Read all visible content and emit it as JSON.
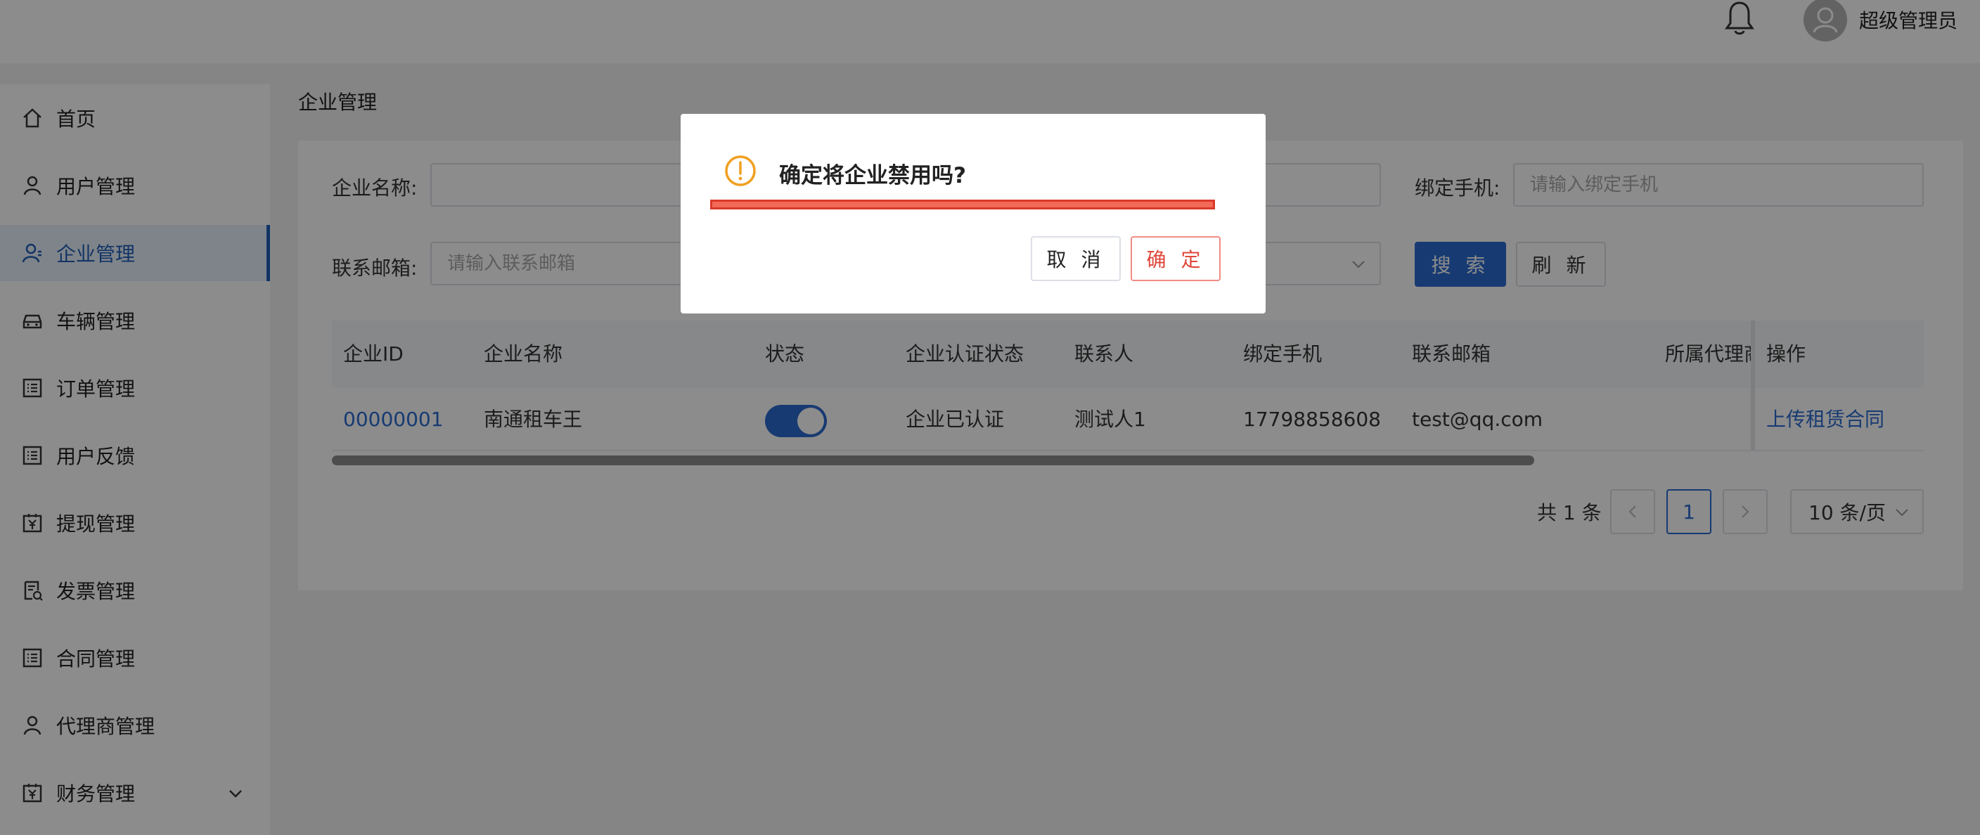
{
  "header": {
    "username": "超级管理员"
  },
  "sidebar": {
    "items": [
      {
        "label": "首页",
        "icon": "home-icon"
      },
      {
        "label": "用户管理",
        "icon": "user-icon"
      },
      {
        "label": "企业管理",
        "icon": "enterprise-icon",
        "active": true
      },
      {
        "label": "车辆管理",
        "icon": "car-icon"
      },
      {
        "label": "订单管理",
        "icon": "list-icon"
      },
      {
        "label": "用户反馈",
        "icon": "list-icon"
      },
      {
        "label": "提现管理",
        "icon": "withdraw-icon"
      },
      {
        "label": "发票管理",
        "icon": "invoice-icon"
      },
      {
        "label": "合同管理",
        "icon": "list-icon"
      },
      {
        "label": "代理商管理",
        "icon": "user-icon"
      },
      {
        "label": "财务管理",
        "icon": "finance-icon"
      }
    ]
  },
  "breadcrumb": "企业管理",
  "filters": {
    "company_name_label": "企业名称:",
    "phone_label": "绑定手机:",
    "phone_placeholder": "请输入绑定手机",
    "email_label": "联系邮箱:",
    "email_placeholder": "请输入联系邮箱",
    "search_label": "搜 索",
    "refresh_label": "刷 新"
  },
  "table": {
    "columns": [
      "企业ID",
      "企业名称",
      "状态",
      "企业认证状态",
      "联系人",
      "绑定手机",
      "联系邮箱",
      "所属代理商",
      "操作"
    ],
    "rows": [
      {
        "id": "00000001",
        "name": "南通租车王",
        "status_on": true,
        "cert": "企业已认证",
        "contact": "测试人1",
        "phone": "17798858608",
        "email": "test@qq.com",
        "agent": "",
        "action": "上传租赁合同"
      }
    ]
  },
  "pagination": {
    "total": "共 1 条",
    "current": "1",
    "page_size": "10 条/页"
  },
  "dialog": {
    "title": "确定将企业禁用吗?",
    "cancel": "取 消",
    "confirm": "确 定"
  },
  "colors": {
    "primary": "#2b6bd0",
    "warning": "#f0a020",
    "danger": "#e0463a"
  }
}
